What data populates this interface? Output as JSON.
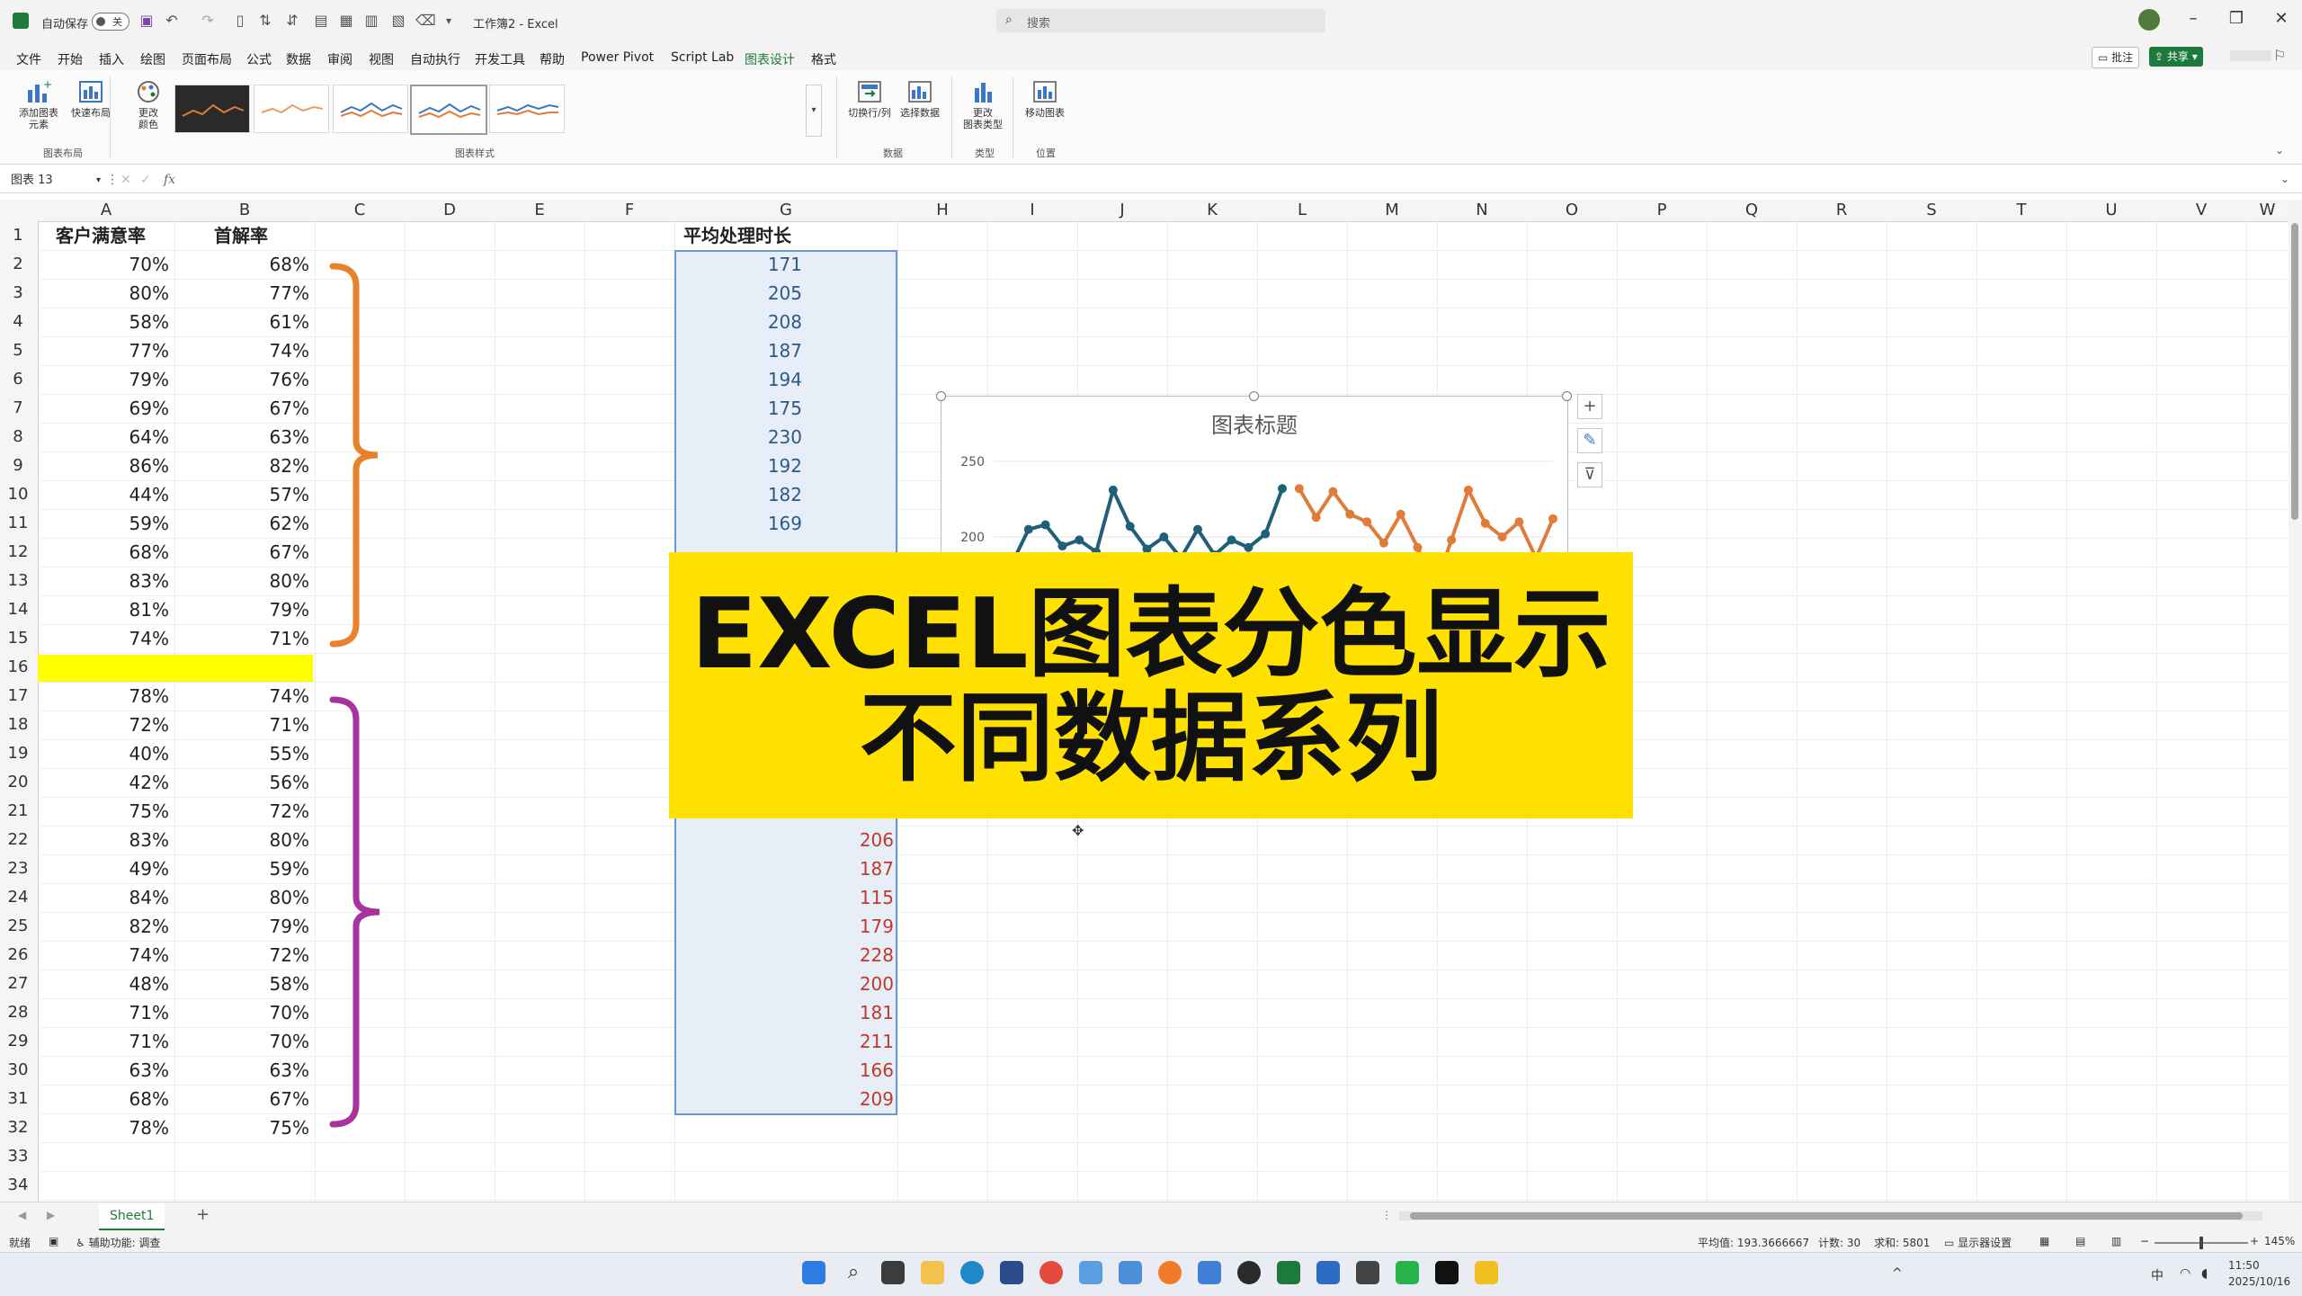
{
  "titlebar": {
    "autosave_label": "自动保存",
    "autosave_state": "关",
    "doc_title": "工作簿2 - Excel",
    "search_placeholder": "搜索"
  },
  "menu": {
    "tabs": [
      "文件",
      "开始",
      "插入",
      "绘图",
      "页面布局",
      "公式",
      "数据",
      "审阅",
      "视图",
      "自动执行",
      "开发工具",
      "帮助",
      "Power Pivot",
      "Script Lab",
      "图表设计",
      "格式"
    ],
    "active": "图表设计",
    "comments": "批注",
    "share": "共享"
  },
  "ribbon": {
    "add_element": "添加图表\n元素",
    "quick_layout": "快速布局",
    "change_color": "更改\n颜色",
    "switch_rowcol": "切换行/列",
    "select_data": "选择数据",
    "change_type": "更改\n图表类型",
    "move_chart": "移动图表",
    "groups": {
      "layout": "图表布局",
      "styles": "图表样式",
      "data": "数据",
      "type": "类型",
      "location": "位置"
    }
  },
  "formula": {
    "namebox": "图表 13",
    "fx": "fx"
  },
  "columns": [
    "A",
    "B",
    "C",
    "D",
    "E",
    "F",
    "G",
    "H",
    "I",
    "J",
    "K",
    "L",
    "M",
    "N",
    "O",
    "P",
    "Q",
    "R",
    "S",
    "T",
    "U",
    "V",
    "W"
  ],
  "rows": [
    "1",
    "2",
    "3",
    "4",
    "5",
    "6",
    "7",
    "8",
    "9",
    "10",
    "11",
    "12",
    "13",
    "14",
    "15",
    "16",
    "17",
    "18",
    "19",
    "20",
    "21",
    "22",
    "23",
    "24",
    "25",
    "26",
    "27",
    "28",
    "29",
    "30",
    "31",
    "32",
    "33",
    "34"
  ],
  "sheet": {
    "header_a": "客户满意率",
    "header_b": "首解率",
    "header_g": "平均处理时长",
    "col_a": [
      "70%",
      "80%",
      "58%",
      "77%",
      "79%",
      "69%",
      "64%",
      "86%",
      "44%",
      "59%",
      "68%",
      "83%",
      "81%",
      "74%",
      "",
      "78%",
      "72%",
      "40%",
      "42%",
      "75%",
      "83%",
      "49%",
      "84%",
      "82%",
      "74%",
      "48%",
      "71%",
      "71%",
      "63%",
      "68%",
      "78%"
    ],
    "col_b": [
      "68%",
      "77%",
      "61%",
      "74%",
      "76%",
      "67%",
      "63%",
      "82%",
      "57%",
      "62%",
      "67%",
      "80%",
      "79%",
      "71%",
      "",
      "74%",
      "71%",
      "55%",
      "56%",
      "72%",
      "80%",
      "59%",
      "80%",
      "79%",
      "72%",
      "58%",
      "70%",
      "70%",
      "63%",
      "67%",
      "75%"
    ],
    "col_g_visible_top": [
      "171",
      "205",
      "208",
      "187",
      "194",
      "175",
      "230",
      "192",
      "182",
      "169"
    ],
    "col_h_visible_bottom": [
      "206",
      "187",
      "115",
      "179",
      "228",
      "200",
      "181",
      "211",
      "166",
      "209"
    ]
  },
  "chart_data": {
    "type": "line",
    "title": "图表标题",
    "ylim": [
      150,
      250
    ],
    "yticks": [
      150,
      200,
      250
    ],
    "series": [
      {
        "color": "#1f5f7a",
        "values": [
          182,
          205,
          208,
          194,
          198,
          190,
          231,
          207,
          192,
          200,
          186,
          205,
          188,
          198,
          193,
          202,
          232
        ]
      },
      {
        "color": "#e07b39",
        "values": [
          232,
          213,
          230,
          215,
          210,
          196,
          215,
          193,
          166,
          198,
          231,
          209,
          200,
          210,
          186,
          212
        ]
      }
    ]
  },
  "banner": {
    "line1": "EXCEL图表分色显示",
    "line2": "不同数据系列"
  },
  "sheettab": "Sheet1",
  "status": {
    "ready": "就绪",
    "accessibility": "辅助功能: 调查",
    "average": "平均值: 193.3666667",
    "count": "计数: 30",
    "sum": "求和: 5801",
    "display_settings": "显示器设置",
    "zoom": "145%"
  },
  "taskbar": {
    "time": "11:50",
    "date": "2025/10/16",
    "ime": "中"
  },
  "colors": {
    "excel_green": "#1e7a3c",
    "orange_brace": "#e8832c",
    "purple_brace": "#a6349c",
    "red_text": "#c0392b",
    "banner_yellow": "#ffe100",
    "highlight_yellow": "#ffff00"
  }
}
